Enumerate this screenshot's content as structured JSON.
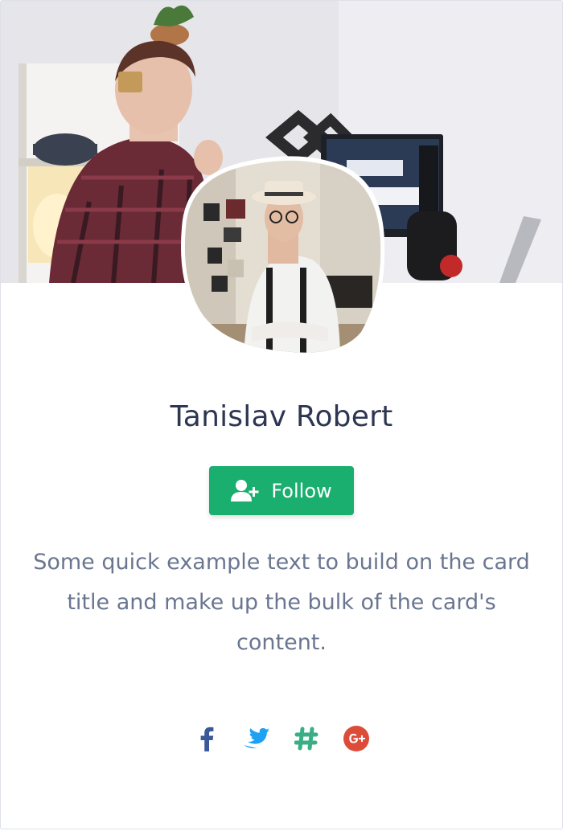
{
  "profile": {
    "name": "Tanislav Robert",
    "follow_label": "Follow",
    "description": "Some quick example text to build on the card title and make up the bulk of the card's content."
  },
  "images": {
    "cover": "cover-photo-person-at-desk",
    "avatar": "avatar-man-in-hat-with-suspenders"
  },
  "social": [
    {
      "name": "facebook-icon",
      "color": "#3b5998"
    },
    {
      "name": "twitter-icon",
      "color": "#1da1f2"
    },
    {
      "name": "slack-icon",
      "color": "#3aaf85"
    },
    {
      "name": "google-plus-icon",
      "color": "#dd4b39"
    }
  ],
  "colors": {
    "title": "#2d3652",
    "text": "#6a7690",
    "follow_button": "#1aae6f",
    "card_border": "#dde1e7"
  }
}
